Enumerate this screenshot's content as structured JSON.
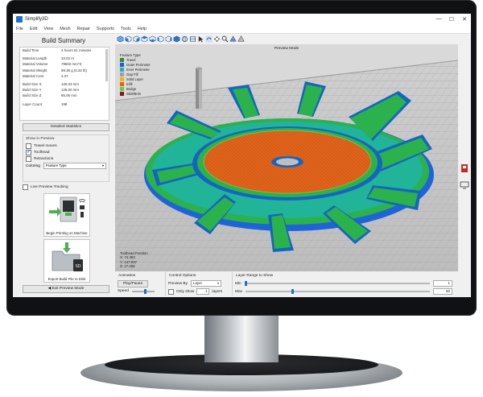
{
  "window": {
    "title": "Simplify3D",
    "minimize": "—",
    "maximize": "☐",
    "close": "✕"
  },
  "menu": [
    "File",
    "Edit",
    "View",
    "Mesh",
    "Repair",
    "Supports",
    "Tools",
    "Help"
  ],
  "summary": {
    "heading": "Build Summary",
    "rows": [
      {
        "label": "Build Time",
        "value": "4 hours 51 minutes"
      },
      {
        "label": "Material Length",
        "value": "33.03 m"
      },
      {
        "label": "Material Volume",
        "value": "79502 mm^3"
      },
      {
        "label": "Material Weight",
        "value": "99.38 g (0.22 lb)"
      },
      {
        "label": "Material Cost",
        "value": "4.37"
      },
      {
        "label": "Build Size X",
        "value": "125.03 mm"
      },
      {
        "label": "Build Size Y",
        "value": "125.00 mm"
      },
      {
        "label": "Build Size Z",
        "value": "65.06 mm"
      },
      {
        "label": "Layer Count",
        "value": "198"
      }
    ],
    "detailed_button": "Detailed Statistics"
  },
  "show_in_preview": {
    "title": "Show in Preview",
    "options": [
      {
        "label": "Travel moves",
        "checked": false
      },
      {
        "label": "Toolhead",
        "checked": true
      },
      {
        "label": "Retractions",
        "checked": false
      }
    ],
    "coloring_label": "Coloring",
    "coloring_value": "Feature Type",
    "live_preview": "Live Preview Tracking"
  },
  "actions": {
    "begin_printing": "Begin Printing on Machine",
    "export": "Export Build File to Disk",
    "exit_preview": "Exit Preview Mode"
  },
  "viewport": {
    "mode_label": "Preview Mode",
    "legend_title": "Feature Type",
    "legend": [
      {
        "label": "Travel",
        "color": "#2e8b2e"
      },
      {
        "label": "Outer Perimeter",
        "color": "#1565c0"
      },
      {
        "label": "Inner Perimeter",
        "color": "#2aa8c8"
      },
      {
        "label": "Gap Fill",
        "color": "#a0a0a0"
      },
      {
        "label": "Solid Layer",
        "color": "#f2b705"
      },
      {
        "label": "Infill",
        "color": "#e0641c"
      },
      {
        "label": "Bridge",
        "color": "#7cc242"
      },
      {
        "label": "Skirt/Brim",
        "color": "#7a1c1c"
      }
    ],
    "toolhead_title": "Toolhead Position",
    "toolhead_x": "X: 74.383",
    "toolhead_y": "Y: 147.937",
    "toolhead_z": "Z: 17.455"
  },
  "animation": {
    "title": "Animation",
    "play_pause": "Play/Pause",
    "speed_label": "Speed",
    "speed_level": 0.55
  },
  "control_options": {
    "title": "Control Options",
    "preview_by_label": "Preview By",
    "preview_by_value": "Layer",
    "only_show_label": "Only show",
    "only_show_value": "1",
    "layers_label": "layers"
  },
  "layer_range": {
    "title": "Layer Range to Show",
    "min_label": "Min",
    "min_value": "1",
    "max_label": "Max",
    "max_value": "50",
    "max_fraction": 0.25
  }
}
